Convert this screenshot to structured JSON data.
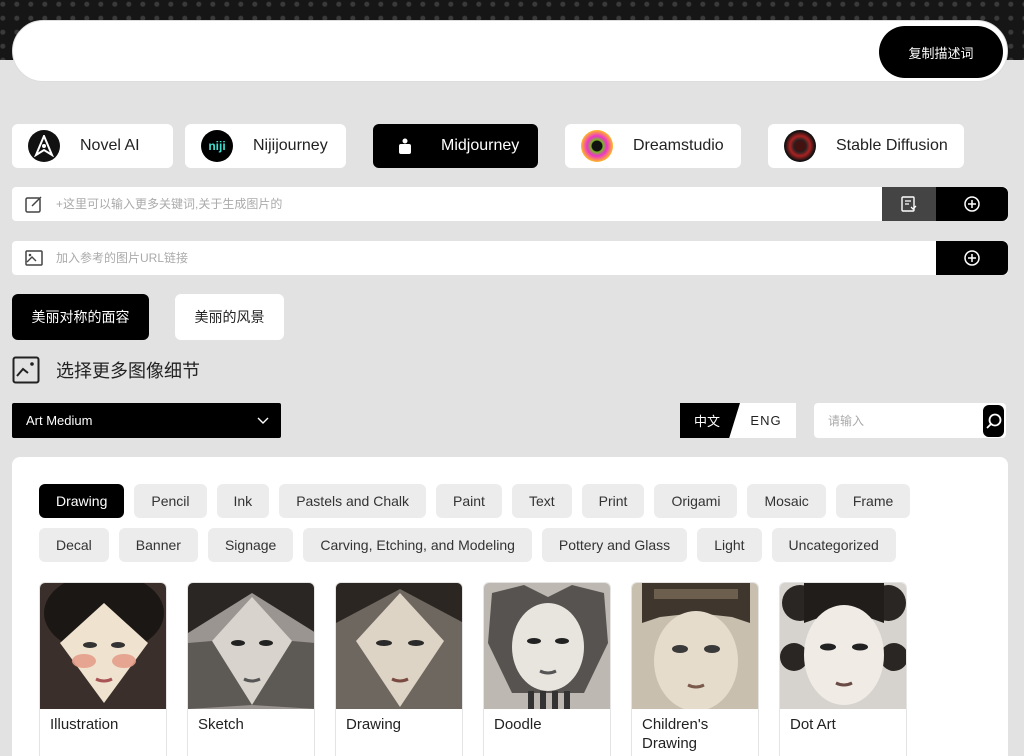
{
  "prompt": {
    "copy_label": "复制描述词"
  },
  "models": [
    {
      "label": "Novel AI",
      "active": false
    },
    {
      "label": "Nijijourney",
      "logo_text": "niji",
      "active": false
    },
    {
      "label": "Midjourney",
      "active": true
    },
    {
      "label": "Dreamstudio",
      "active": false
    },
    {
      "label": "Stable Diffusion",
      "active": false
    }
  ],
  "keyword_input": {
    "placeholder": "+这里可以输入更多关键词,关于生成图片的"
  },
  "url_input": {
    "placeholder": "加入参考的图片URL链接"
  },
  "presets": {
    "selected": "美丽对称的面容",
    "other": "美丽的风景"
  },
  "details": {
    "title": "选择更多图像细节"
  },
  "category_select": {
    "value": "Art Medium"
  },
  "language": {
    "zh": "中文",
    "en": "ENG"
  },
  "search": {
    "placeholder": "请输入"
  },
  "chips_row1": [
    "Drawing",
    "Pencil",
    "Ink",
    "Pastels and Chalk",
    "Paint",
    "Text",
    "Print",
    "Origami",
    "Mosaic",
    "Frame"
  ],
  "chips_row2": [
    "Decal",
    "Banner",
    "Signage",
    "Carving, Etching, and Modeling",
    "Pottery and Glass",
    "Light",
    "Uncategorized"
  ],
  "cards": [
    "Illustration",
    "Sketch",
    "Drawing",
    "Doodle",
    "Children's Drawing",
    "Dot Art"
  ],
  "colors": {
    "accent": "#000000",
    "background": "#e2e2e2"
  }
}
